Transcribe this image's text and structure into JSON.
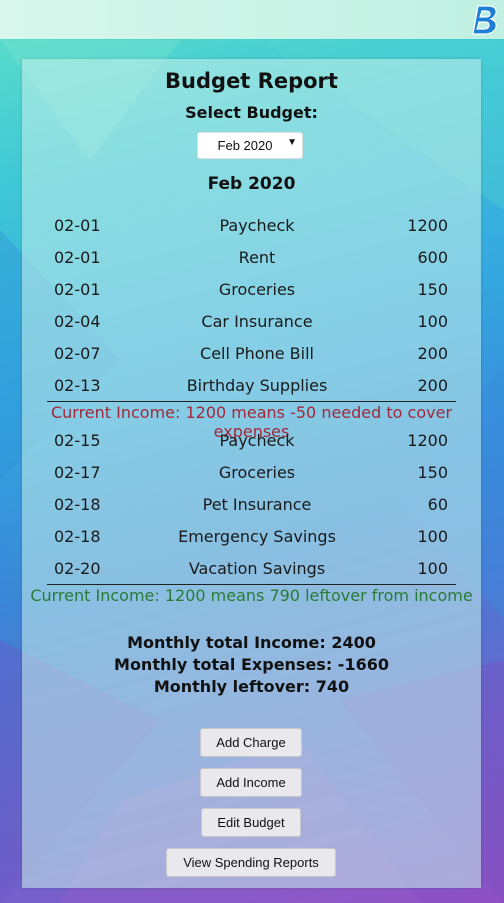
{
  "header": {
    "logo_letter": "B"
  },
  "report": {
    "title": "Budget Report",
    "select_label": "Select Budget:",
    "selected_budget": "Feb 2020",
    "month_heading": "Feb 2020"
  },
  "section1": {
    "rows": [
      {
        "date": "02-01",
        "name": "Paycheck",
        "amount": "1200"
      },
      {
        "date": "02-01",
        "name": "Rent",
        "amount": "600"
      },
      {
        "date": "02-01",
        "name": "Groceries",
        "amount": "150"
      },
      {
        "date": "02-04",
        "name": "Car Insurance",
        "amount": "100"
      },
      {
        "date": "02-07",
        "name": "Cell Phone Bill",
        "amount": "200"
      },
      {
        "date": "02-13",
        "name": "Birthday Supplies",
        "amount": "200"
      }
    ],
    "note": "Current Income: 1200 means -50 needed to cover expenses"
  },
  "section2": {
    "rows": [
      {
        "date": "02-15",
        "name": "Paycheck",
        "amount": "1200"
      },
      {
        "date": "02-17",
        "name": "Groceries",
        "amount": "150"
      },
      {
        "date": "02-18",
        "name": "Pet Insurance",
        "amount": "60"
      },
      {
        "date": "02-18",
        "name": "Emergency Savings",
        "amount": "100"
      },
      {
        "date": "02-20",
        "name": "Vacation Savings",
        "amount": "100"
      }
    ],
    "note": "Current Income: 1200 means 790 leftover from income"
  },
  "totals": {
    "income": "Monthly total Income: 2400",
    "expenses": "Monthly total Expenses: -1660",
    "leftover": "Monthly leftover: 740"
  },
  "buttons": {
    "add_charge": "Add Charge",
    "add_income": "Add Income",
    "edit_budget": "Edit Budget",
    "view_reports": "View Spending Reports"
  },
  "colors": {
    "negative_note": "#a2283a",
    "positive_note": "#2a7a35",
    "logo": "#1f7fd6"
  }
}
